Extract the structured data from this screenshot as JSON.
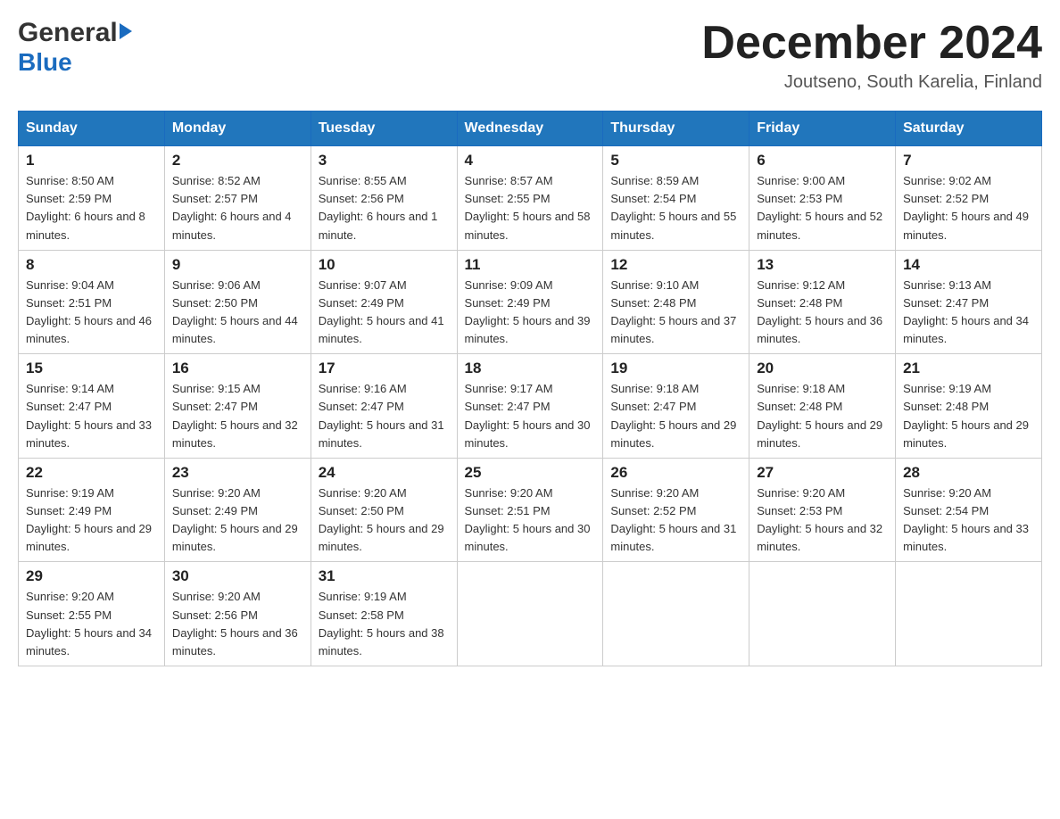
{
  "logo": {
    "general": "General",
    "blue": "Blue"
  },
  "header": {
    "title": "December 2024",
    "subtitle": "Joutseno, South Karelia, Finland"
  },
  "columns": [
    "Sunday",
    "Monday",
    "Tuesday",
    "Wednesday",
    "Thursday",
    "Friday",
    "Saturday"
  ],
  "weeks": [
    [
      {
        "day": "1",
        "sunrise": "8:50 AM",
        "sunset": "2:59 PM",
        "daylight": "6 hours and 8 minutes."
      },
      {
        "day": "2",
        "sunrise": "8:52 AM",
        "sunset": "2:57 PM",
        "daylight": "6 hours and 4 minutes."
      },
      {
        "day": "3",
        "sunrise": "8:55 AM",
        "sunset": "2:56 PM",
        "daylight": "6 hours and 1 minute."
      },
      {
        "day": "4",
        "sunrise": "8:57 AM",
        "sunset": "2:55 PM",
        "daylight": "5 hours and 58 minutes."
      },
      {
        "day": "5",
        "sunrise": "8:59 AM",
        "sunset": "2:54 PM",
        "daylight": "5 hours and 55 minutes."
      },
      {
        "day": "6",
        "sunrise": "9:00 AM",
        "sunset": "2:53 PM",
        "daylight": "5 hours and 52 minutes."
      },
      {
        "day": "7",
        "sunrise": "9:02 AM",
        "sunset": "2:52 PM",
        "daylight": "5 hours and 49 minutes."
      }
    ],
    [
      {
        "day": "8",
        "sunrise": "9:04 AM",
        "sunset": "2:51 PM",
        "daylight": "5 hours and 46 minutes."
      },
      {
        "day": "9",
        "sunrise": "9:06 AM",
        "sunset": "2:50 PM",
        "daylight": "5 hours and 44 minutes."
      },
      {
        "day": "10",
        "sunrise": "9:07 AM",
        "sunset": "2:49 PM",
        "daylight": "5 hours and 41 minutes."
      },
      {
        "day": "11",
        "sunrise": "9:09 AM",
        "sunset": "2:49 PM",
        "daylight": "5 hours and 39 minutes."
      },
      {
        "day": "12",
        "sunrise": "9:10 AM",
        "sunset": "2:48 PM",
        "daylight": "5 hours and 37 minutes."
      },
      {
        "day": "13",
        "sunrise": "9:12 AM",
        "sunset": "2:48 PM",
        "daylight": "5 hours and 36 minutes."
      },
      {
        "day": "14",
        "sunrise": "9:13 AM",
        "sunset": "2:47 PM",
        "daylight": "5 hours and 34 minutes."
      }
    ],
    [
      {
        "day": "15",
        "sunrise": "9:14 AM",
        "sunset": "2:47 PM",
        "daylight": "5 hours and 33 minutes."
      },
      {
        "day": "16",
        "sunrise": "9:15 AM",
        "sunset": "2:47 PM",
        "daylight": "5 hours and 32 minutes."
      },
      {
        "day": "17",
        "sunrise": "9:16 AM",
        "sunset": "2:47 PM",
        "daylight": "5 hours and 31 minutes."
      },
      {
        "day": "18",
        "sunrise": "9:17 AM",
        "sunset": "2:47 PM",
        "daylight": "5 hours and 30 minutes."
      },
      {
        "day": "19",
        "sunrise": "9:18 AM",
        "sunset": "2:47 PM",
        "daylight": "5 hours and 29 minutes."
      },
      {
        "day": "20",
        "sunrise": "9:18 AM",
        "sunset": "2:48 PM",
        "daylight": "5 hours and 29 minutes."
      },
      {
        "day": "21",
        "sunrise": "9:19 AM",
        "sunset": "2:48 PM",
        "daylight": "5 hours and 29 minutes."
      }
    ],
    [
      {
        "day": "22",
        "sunrise": "9:19 AM",
        "sunset": "2:49 PM",
        "daylight": "5 hours and 29 minutes."
      },
      {
        "day": "23",
        "sunrise": "9:20 AM",
        "sunset": "2:49 PM",
        "daylight": "5 hours and 29 minutes."
      },
      {
        "day": "24",
        "sunrise": "9:20 AM",
        "sunset": "2:50 PM",
        "daylight": "5 hours and 29 minutes."
      },
      {
        "day": "25",
        "sunrise": "9:20 AM",
        "sunset": "2:51 PM",
        "daylight": "5 hours and 30 minutes."
      },
      {
        "day": "26",
        "sunrise": "9:20 AM",
        "sunset": "2:52 PM",
        "daylight": "5 hours and 31 minutes."
      },
      {
        "day": "27",
        "sunrise": "9:20 AM",
        "sunset": "2:53 PM",
        "daylight": "5 hours and 32 minutes."
      },
      {
        "day": "28",
        "sunrise": "9:20 AM",
        "sunset": "2:54 PM",
        "daylight": "5 hours and 33 minutes."
      }
    ],
    [
      {
        "day": "29",
        "sunrise": "9:20 AM",
        "sunset": "2:55 PM",
        "daylight": "5 hours and 34 minutes."
      },
      {
        "day": "30",
        "sunrise": "9:20 AM",
        "sunset": "2:56 PM",
        "daylight": "5 hours and 36 minutes."
      },
      {
        "day": "31",
        "sunrise": "9:19 AM",
        "sunset": "2:58 PM",
        "daylight": "5 hours and 38 minutes."
      },
      null,
      null,
      null,
      null
    ]
  ]
}
